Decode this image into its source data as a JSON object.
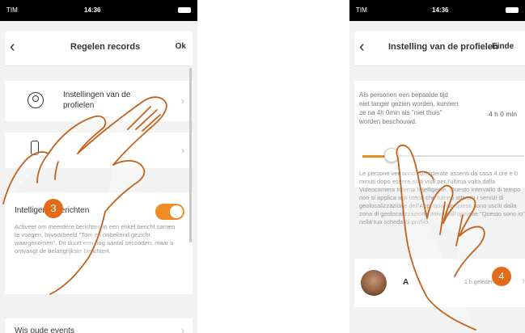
{
  "left": {
    "status": {
      "carrier": "TIM",
      "time": "14:36"
    },
    "nav": {
      "title": "Regelen records",
      "action": "Ok"
    },
    "rows": {
      "profiles_label": "Instellingen van de profielen",
      "second_label": "",
      "notifications_label": "Intelligente berichten",
      "notifications_desc": "Activeer om meerdere berichten in een enkel bericht samen te voegen, bijvoorbeeld \"Tom en onbekend gezicht waargenomen\". Dit duurt een nog aantal seconden, maar u ontvangt de belangrijkste berichten.",
      "delete_label": "Wis oude events"
    },
    "badge": "3"
  },
  "right": {
    "status": {
      "carrier": "TIM",
      "time": "14:36"
    },
    "nav": {
      "title": "Instelling van de profielen",
      "action": "Einde"
    },
    "description": "Als personen een bepaalde tijd niet langer gezien worden, kunnen ze na 4h 0min als \"niet thuis\" worden beschouwd.",
    "time_value": "4 h 0 min",
    "slider_fraction": 0.18,
    "italian_text": "Le persone verranno considerate assenti da casa 4 ore e 0 minuti dopo essere stati visti per l'ultima volta dalla Videocamera Interna Intelligente. Questo intervallo di tempo non si applica agli utenti che hanno attivato i servizi di geolocalizzazione dell'App, quando questi sono usciti dalla zona di geolocalizzazione attiva dall'opzione \"Questo sono io\" nella tua scheda di profilo.",
    "profile_name": "A",
    "profile_time": "1 h geleden",
    "badge": "4"
  },
  "colors": {
    "accent": "#f08a24",
    "badge": "#e36a18",
    "hand_stroke": "#c2611a"
  }
}
